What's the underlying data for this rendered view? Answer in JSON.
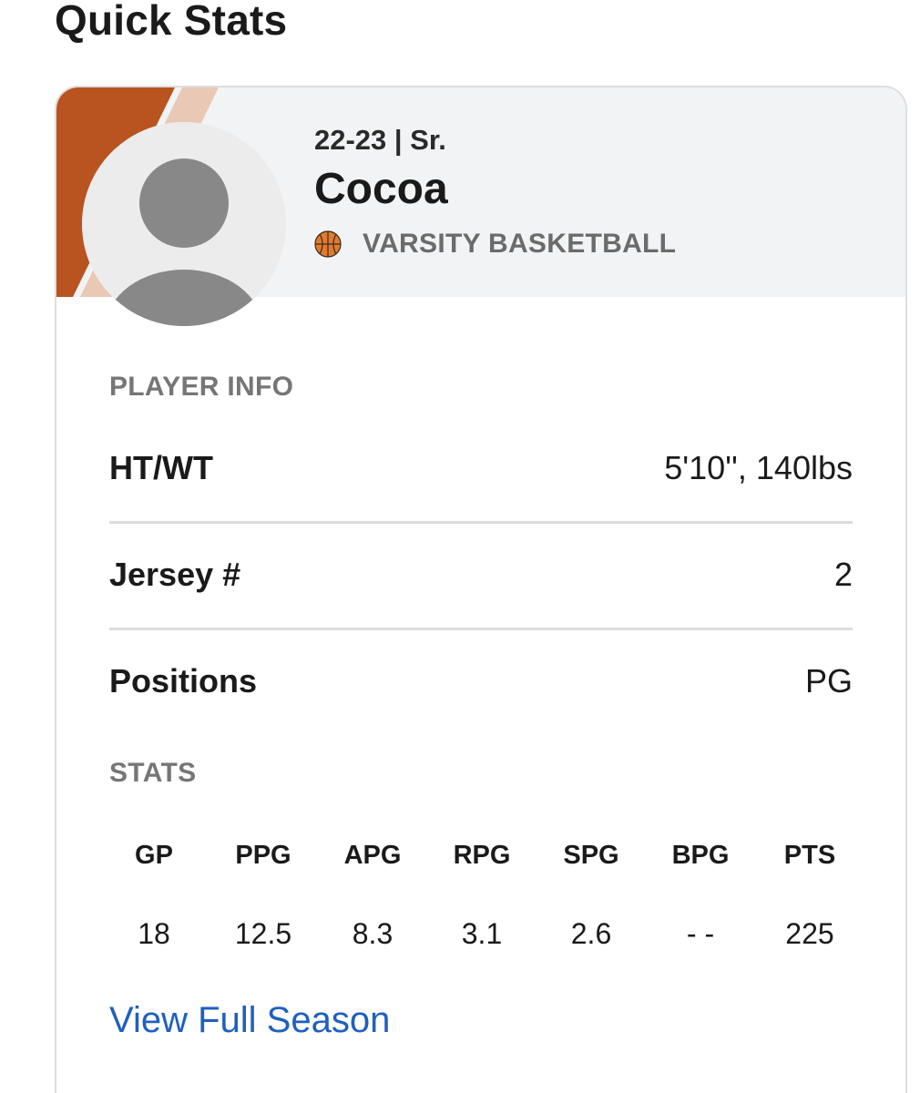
{
  "page": {
    "title": "Quick Stats"
  },
  "player": {
    "season_line": "22-23 | Sr.",
    "name": "Cocoa",
    "sport_icon": "basketball-icon",
    "sport": "VARSITY BASKETBALL"
  },
  "player_info": {
    "label": "PLAYER INFO",
    "rows": [
      {
        "key": "HT/WT",
        "value": "5'10'', 140lbs"
      },
      {
        "key": "Jersey #",
        "value": "2"
      },
      {
        "key": "Positions",
        "value": "PG"
      }
    ]
  },
  "stats": {
    "label": "STATS",
    "headers": [
      "GP",
      "PPG",
      "APG",
      "RPG",
      "SPG",
      "BPG",
      "PTS"
    ],
    "values": [
      "18",
      "12.5",
      "8.3",
      "3.1",
      "2.6",
      "- -",
      "225"
    ]
  },
  "links": {
    "view_full_season": "View Full Season"
  },
  "colors": {
    "accent_orange": "#b9531f",
    "accent_light": "#e9c8b6",
    "link_blue": "#1f5fbf",
    "header_bg": "#f2f3f4"
  }
}
